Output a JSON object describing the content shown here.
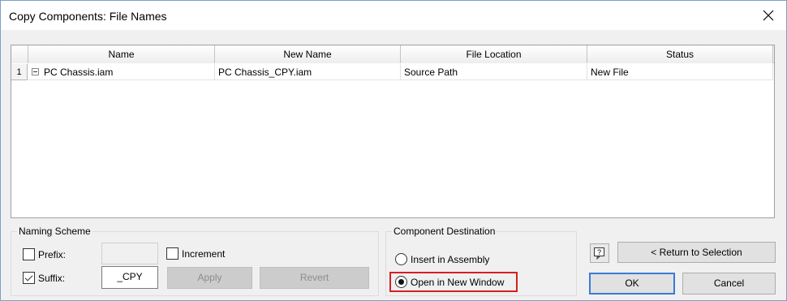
{
  "window": {
    "title": "Copy Components: File Names"
  },
  "grid": {
    "columns": [
      "Name",
      "New Name",
      "File Location",
      "Status"
    ],
    "rows": [
      {
        "index": "1",
        "name": "PC Chassis.iam",
        "new_name": "PC Chassis_CPY.iam",
        "file_location": "Source Path",
        "status": "New File"
      }
    ]
  },
  "naming_scheme": {
    "title": "Naming Scheme",
    "prefix_label": "Prefix:",
    "prefix_checked": false,
    "prefix_value": "",
    "suffix_label": "Suffix:",
    "suffix_checked": true,
    "suffix_value": "_CPY",
    "increment_label": "Increment",
    "increment_checked": false,
    "apply_label": "Apply",
    "revert_label": "Revert"
  },
  "component_destination": {
    "title": "Component Destination",
    "options": [
      {
        "label": "Insert in Assembly",
        "selected": false
      },
      {
        "label": "Open in New Window",
        "selected": true
      }
    ]
  },
  "buttons": {
    "help_icon": "question-mark-icon",
    "return_label": "< Return to Selection",
    "ok_label": "OK",
    "cancel_label": "Cancel"
  },
  "colors": {
    "highlight": "#d6201f",
    "window_border": "#7a9fc9",
    "default_button_border": "#3a7bd5"
  }
}
